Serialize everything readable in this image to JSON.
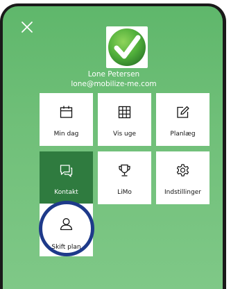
{
  "user": {
    "name": "Lone Petersen",
    "email": "lone@mobilize-me.com"
  },
  "menu": {
    "tiles": [
      {
        "label": "Min dag",
        "icon": "calendar-icon",
        "active": false
      },
      {
        "label": "Vis uge",
        "icon": "grid-icon",
        "active": false
      },
      {
        "label": "Planlæg",
        "icon": "edit-icon",
        "active": false
      },
      {
        "label": "Kontakt",
        "icon": "chat-icon",
        "active": true
      },
      {
        "label": "LiMo",
        "icon": "trophy-icon",
        "active": false
      },
      {
        "label": "Indstillinger",
        "icon": "gear-icon",
        "active": false
      },
      {
        "label": "Skift plan",
        "icon": "user-icon",
        "active": false
      }
    ]
  },
  "colors": {
    "background": "#6fbf78",
    "active_tile": "#2f7b3f",
    "highlight_ring": "#1e3a8a"
  }
}
